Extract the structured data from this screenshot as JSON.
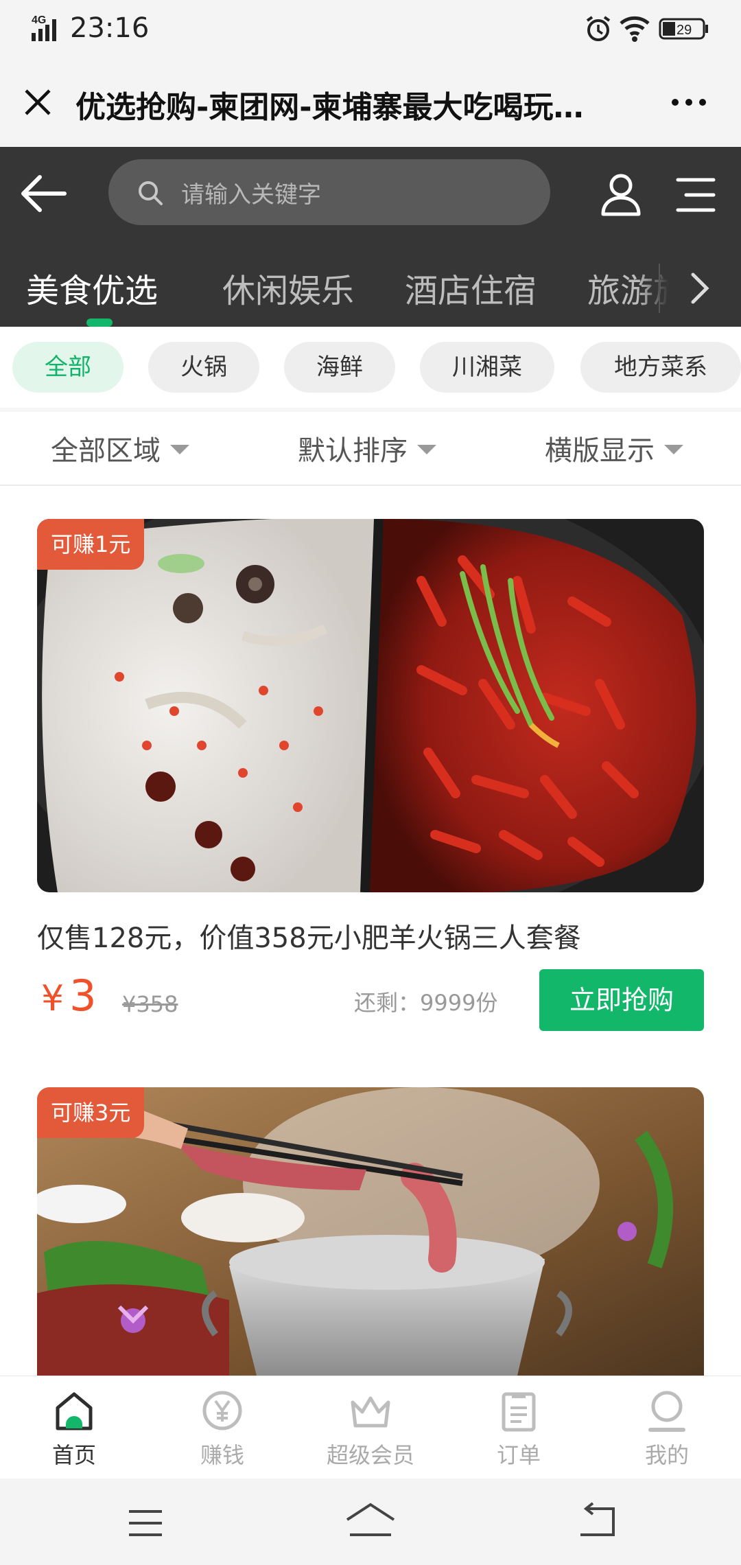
{
  "status_bar": {
    "network": "4G",
    "time": "23:16",
    "battery": "29"
  },
  "title_bar": {
    "title": "优选抢购-柬团网-柬埔寨最大吃喝玩…"
  },
  "search": {
    "placeholder": "请输入关键字"
  },
  "top_tabs": [
    {
      "label": "美食优选"
    },
    {
      "label": "休闲娱乐"
    },
    {
      "label": "酒店住宿"
    },
    {
      "label": "旅游旅"
    }
  ],
  "categories": [
    {
      "label": "全部"
    },
    {
      "label": "火锅"
    },
    {
      "label": "海鲜"
    },
    {
      "label": "川湘菜"
    },
    {
      "label": "地方菜系"
    }
  ],
  "filters": [
    {
      "label": "全部区域"
    },
    {
      "label": "默认排序"
    },
    {
      "label": "横版显示"
    }
  ],
  "products": [
    {
      "badge": "可赚1元",
      "title": "仅售128元，价值358元小肥羊火锅三人套餐",
      "currency": "¥",
      "price": "3",
      "original_price": "¥358",
      "remaining_label": "还剩：",
      "remaining": "9999份",
      "button": "立即抢购"
    },
    {
      "badge": "可赚3元"
    }
  ],
  "bottom_nav": [
    {
      "label": "首页",
      "icon": "home-icon"
    },
    {
      "label": "赚钱",
      "icon": "coin-yen-icon"
    },
    {
      "label": "超级会员",
      "icon": "crown-icon"
    },
    {
      "label": "订单",
      "icon": "clipboard-icon"
    },
    {
      "label": "我的",
      "icon": "user-icon"
    }
  ],
  "colors": {
    "accent": "#12b76a",
    "price": "#f0502a",
    "badge": "#e35a3a",
    "header": "#363636"
  }
}
